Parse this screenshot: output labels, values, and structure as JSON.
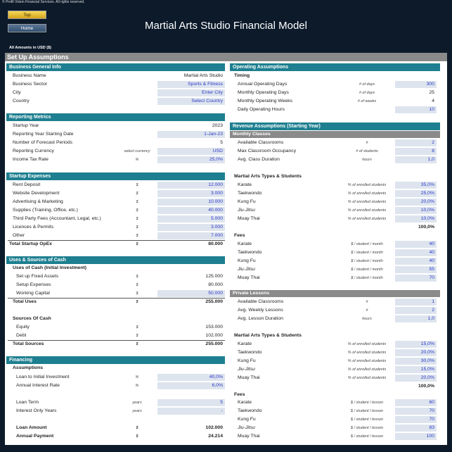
{
  "copyright": "© Profit Vision Financial Services. All rights reserved.",
  "nav": {
    "top": "Top",
    "home": "Home"
  },
  "title": "Martial Arts Studio Financial Model",
  "amounts_note": "All Amounts in  USD ($)",
  "setup_bar": "Set Up Assumptions",
  "business": {
    "header": "Business General Info",
    "rows": [
      {
        "label": "Business Name",
        "value": "Martial Arts Studio"
      },
      {
        "label": "Business Sector",
        "value": "Sports & Fitness"
      },
      {
        "label": "City",
        "value": "Enter City"
      },
      {
        "label": "Country",
        "value": "Select Country"
      }
    ]
  },
  "reporting": {
    "header": "Reporting Metrics",
    "rows": [
      {
        "label": "Startup Year",
        "unit": "",
        "value": "2023"
      },
      {
        "label": "Reporting Year Starting Date",
        "unit": "",
        "value": "1-Jan-23"
      },
      {
        "label": "Number of Forecast Periods",
        "unit": "",
        "value": "5"
      },
      {
        "label": "Reporting Currency",
        "unit": "select currency",
        "value": "USD"
      },
      {
        "label": "Income Tax Rate",
        "unit": "%",
        "value": "25,0%"
      }
    ]
  },
  "startup": {
    "header": "Startup Expenses",
    "rows": [
      {
        "label": "Rent Deposit",
        "unit": "$",
        "value": "12.000"
      },
      {
        "label": "Website Development",
        "unit": "$",
        "value": "3.000"
      },
      {
        "label": "Advertising & Marketing",
        "unit": "$",
        "value": "10.000"
      },
      {
        "label": "Supplies (Training, Office, etc.)",
        "unit": "$",
        "value": "40.000"
      },
      {
        "label": "Third Party Fees (Accountant, Legal, etc.)",
        "unit": "$",
        "value": "5.000"
      },
      {
        "label": "Licences & Permits",
        "unit": "$",
        "value": "3.000"
      },
      {
        "label": "Other",
        "unit": "$",
        "value": "7.000"
      }
    ],
    "total_label": "Total Startup OpEx",
    "total_unit": "$",
    "total_value": "80.000"
  },
  "uses": {
    "header": "Uses & Sources of Cash",
    "uses_title": "Uses of Cash (Initial Investment)",
    "uses_rows": [
      {
        "label": "Set up Fixed Assets",
        "unit": "$",
        "value": "125.000"
      },
      {
        "label": "Setup Expenses",
        "unit": "$",
        "value": "80.000"
      },
      {
        "label": "Working Capital",
        "unit": "$",
        "value": "50.000"
      }
    ],
    "total_uses_label": "Total Uses",
    "total_uses_unit": "$",
    "total_uses_value": "255.000",
    "sources_title": "Sources Of Cash",
    "sources_rows": [
      {
        "label": "Equity",
        "unit": "$",
        "value": "153.000"
      },
      {
        "label": "Debt",
        "unit": "$",
        "value": "102.000"
      }
    ],
    "total_sources_label": "Total Sources",
    "total_sources_unit": "$",
    "total_sources_value": "255.000"
  },
  "financing": {
    "header": "Financing",
    "assumptions_title": "Assumptions",
    "rows": [
      {
        "label": "Loan to Initial Investment",
        "unit": "%",
        "value": "40,0%"
      },
      {
        "label": "Annual Interest Rate",
        "unit": "%",
        "value": "6,0%"
      },
      {
        "label": "Loan Term",
        "unit": "years",
        "value": "5"
      },
      {
        "label": "Interest Only Years",
        "unit": "years",
        "value": "-"
      }
    ],
    "loan_amount_label": "Loan Amount",
    "loan_amount_unit": "$",
    "loan_amount_value": "102.000",
    "annual_payment_label": "Annual Payment",
    "annual_payment_unit": "$",
    "annual_payment_value": "24.214"
  },
  "operating": {
    "header": "Operating Assumptions",
    "timing_title": "Timing",
    "rows": [
      {
        "label": "Annual Operating Days",
        "unit": "# of days",
        "value": "300"
      },
      {
        "label": "Monthly Operating Days",
        "unit": "# of days",
        "value": "25"
      },
      {
        "label": "Monthly Operating Weeks",
        "unit": "# of weeks",
        "value": "4"
      },
      {
        "label": "Daily Operating Hours",
        "unit": "",
        "value": "10"
      }
    ]
  },
  "revenue": {
    "header": "Revenue Assumptions (Starting Year)",
    "monthly": {
      "title": "Monthly Classes",
      "rows": [
        {
          "label": "Available Classrooms",
          "unit": "#",
          "value": "2"
        },
        {
          "label": "Max Classroom Occupancy",
          "unit": "# of students",
          "value": "8"
        },
        {
          "label": "Avg. Class Duration",
          "unit": "hours",
          "value": "1,0"
        }
      ],
      "types_title": "Martial Arts Types & Students",
      "types": [
        {
          "label": "Karate",
          "unit": "% of enrolled students",
          "value": "35,0%"
        },
        {
          "label": "Taekwondo",
          "unit": "% of enrolled students",
          "value": "25,0%"
        },
        {
          "label": "Kung Fu",
          "unit": "% of enrolled students",
          "value": "20,0%"
        },
        {
          "label": "Jiu-Jitsu",
          "unit": "% of enrolled students",
          "value": "10,0%"
        },
        {
          "label": "Muay Thai",
          "unit": "% of enrolled students",
          "value": "10,0%"
        }
      ],
      "types_total": "100,0%",
      "fees_title": "Fees",
      "fees": [
        {
          "label": "Karate",
          "unit": "$ / student / month",
          "value": "40"
        },
        {
          "label": "Taekwondo",
          "unit": "$ / student / month",
          "value": "40"
        },
        {
          "label": "Kung Fu",
          "unit": "$ / student / month",
          "value": "40"
        },
        {
          "label": "Jiu-Jitsu",
          "unit": "$ / student / month",
          "value": "55"
        },
        {
          "label": "Muay Thai",
          "unit": "$ / student / month",
          "value": "70"
        }
      ]
    },
    "private": {
      "title": "Private Lessons",
      "rows": [
        {
          "label": "Available Classrooms",
          "unit": "#",
          "value": "1"
        },
        {
          "label": "Avg. Weekly Lessons",
          "unit": "#",
          "value": "2"
        },
        {
          "label": "Avg. Lesson Duration",
          "unit": "hours",
          "value": "1,0"
        }
      ],
      "types_title": "Martial Arts Types & Students",
      "types": [
        {
          "label": "Karate",
          "unit": "% of enrolled students",
          "value": "15,0%"
        },
        {
          "label": "Taekwondo",
          "unit": "% of enrolled students",
          "value": "20,0%"
        },
        {
          "label": "Kung Fu",
          "unit": "% of enrolled students",
          "value": "30,0%"
        },
        {
          "label": "Jiu-Jitsu",
          "unit": "% of enrolled students",
          "value": "15,0%"
        },
        {
          "label": "Muay Thai",
          "unit": "% of enrolled students",
          "value": "20,0%"
        }
      ],
      "types_total": "100,0%",
      "fees_title": "Fees",
      "fees": [
        {
          "label": "Karate",
          "unit": "$ / student / lesson",
          "value": "60"
        },
        {
          "label": "Taekwondo",
          "unit": "$ / student / lesson",
          "value": "70"
        },
        {
          "label": "Kung Fu",
          "unit": "$ / student / lesson",
          "value": "70"
        },
        {
          "label": "Jiu-Jitsu",
          "unit": "$ / student / lesson",
          "value": "83"
        },
        {
          "label": "Muay Thai",
          "unit": "$ / student / lesson",
          "value": "100"
        }
      ]
    }
  }
}
